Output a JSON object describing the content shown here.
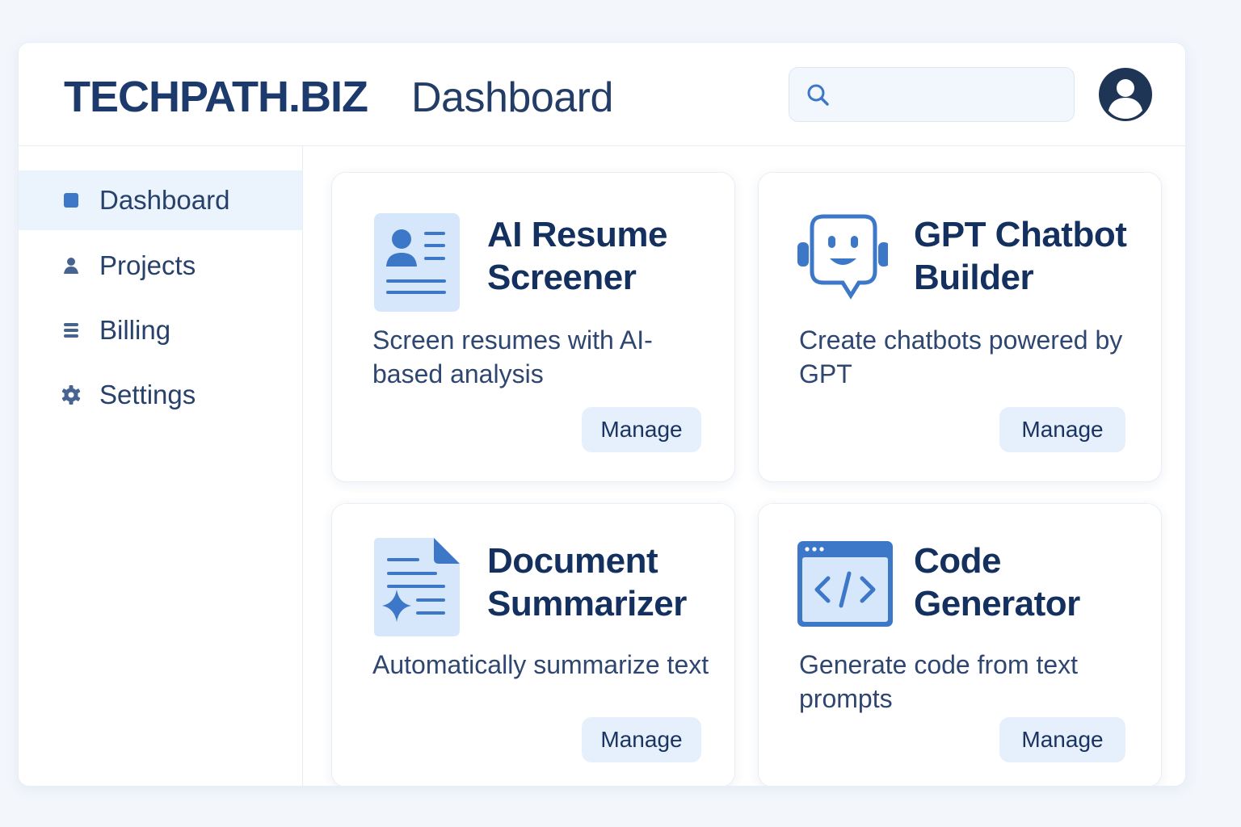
{
  "header": {
    "brand": "TECHPATH.BIZ",
    "title": "Dashboard",
    "search": {
      "placeholder": "",
      "value": ""
    },
    "icons": {
      "search": "search-icon",
      "avatar": "user-avatar-icon"
    }
  },
  "sidebar": {
    "items": [
      {
        "label": "Dashboard",
        "icon": "square-icon",
        "active": true
      },
      {
        "label": "Projects",
        "icon": "person-icon",
        "active": false
      },
      {
        "label": "Billing",
        "icon": "list-icon",
        "active": false
      },
      {
        "label": "Settings",
        "icon": "gear-icon",
        "active": false
      }
    ]
  },
  "cards": [
    {
      "title": "AI Resume Screener",
      "title_line1": "AI Resume",
      "title_line2": "Screener",
      "description": "Screen resumes with AI-based analysis",
      "button": "Manage",
      "icon": "resume-icon"
    },
    {
      "title": "GPT Chatbot Builder",
      "title_line1": "GPT Chatbot",
      "title_line2": "Builder",
      "description": "Create chatbots powered by GPT",
      "button": "Manage",
      "icon": "chatbot-icon"
    },
    {
      "title": "Document Summarizer",
      "title_line1": "Document",
      "title_line2": "Summarizer",
      "description": "Automatically summarize text",
      "button": "Manage",
      "icon": "document-sparkle-icon"
    },
    {
      "title": "Code Generator",
      "title_line1": "Code",
      "title_line2": "Generator",
      "description": "Generate code from text prompts",
      "button": "Manage",
      "icon": "code-window-icon"
    }
  ],
  "colors": {
    "accent": "#3d78c8",
    "brand_text": "#1c3a6b",
    "active_nav_bg": "#ebf3fd",
    "button_bg": "#e6f0fc",
    "page_bg": "#f3f7fc"
  }
}
